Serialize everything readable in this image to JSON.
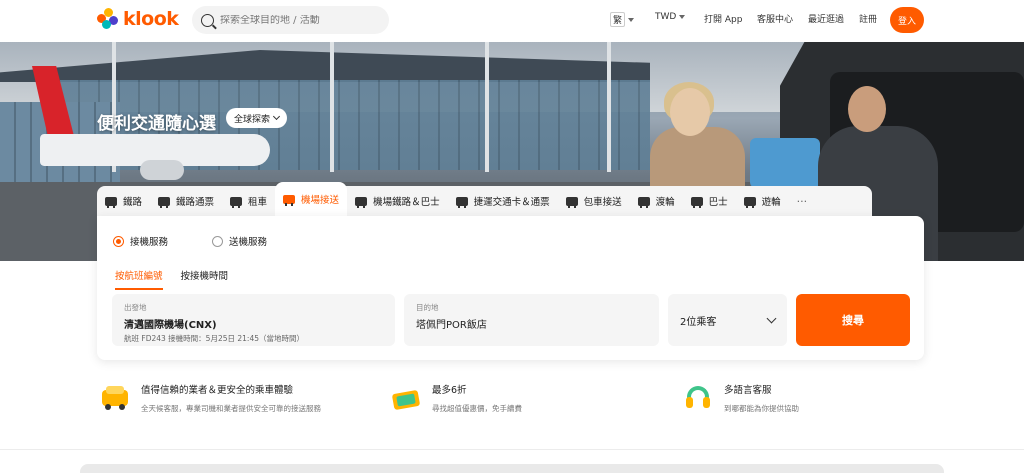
{
  "header": {
    "logo_text": "klook",
    "search_placeholder": "探索全球目的地 / 活動",
    "lang": "繁",
    "currency": "TWD",
    "open_app": "打開 App",
    "help": "客服中心",
    "recent": "最近逛過",
    "register": "註冊",
    "login": "登入"
  },
  "hero": {
    "title": "便利交通隨心選",
    "explore": "全球探索"
  },
  "tabs": [
    {
      "label": "鐵路",
      "icon": "train-icon"
    },
    {
      "label": "鐵路通票",
      "icon": "rail-pass-icon"
    },
    {
      "label": "租車",
      "icon": "car-rental-icon"
    },
    {
      "label": "機場接送",
      "icon": "airport-transfer-icon"
    },
    {
      "label": "機場鐵路＆巴士",
      "icon": "airport-rail-icon"
    },
    {
      "label": "捷運交通卡＆通票",
      "icon": "metro-card-icon"
    },
    {
      "label": "包車接送",
      "icon": "chartered-car-icon"
    },
    {
      "label": "渡輪",
      "icon": "ferry-icon"
    },
    {
      "label": "巴士",
      "icon": "bus-icon"
    },
    {
      "label": "遊輪",
      "icon": "cruise-icon"
    }
  ],
  "more": "···",
  "panel": {
    "radio_pickup": "接機服務",
    "radio_dropoff": "送機服務",
    "subtab_flight": "按航班編號",
    "subtab_time": "按接機時間",
    "from_label": "出發地",
    "from_value": "清邁國際機場(CNX)",
    "from_sub": "航班 FD243 接機時間：5月25日 21:45（當地時間）",
    "to_label": "目的地",
    "to_value": "塔佩門POR飯店",
    "passengers": "2位乘客",
    "search": "搜尋"
  },
  "features": [
    {
      "title": "值得信賴的業者＆更安全的乘車體驗",
      "desc": "全天候客服，專業司機和業者提供安全可靠的接送服務",
      "icon": "car-safety-icon"
    },
    {
      "title": "最多6折",
      "desc": "尋找超值優惠價，免手續費",
      "icon": "ticket-discount-icon"
    },
    {
      "title": "多語言客服",
      "desc": "到哪都能為你提供協助",
      "icon": "headset-icon"
    }
  ],
  "colors": {
    "accent": "#ff5b00"
  }
}
